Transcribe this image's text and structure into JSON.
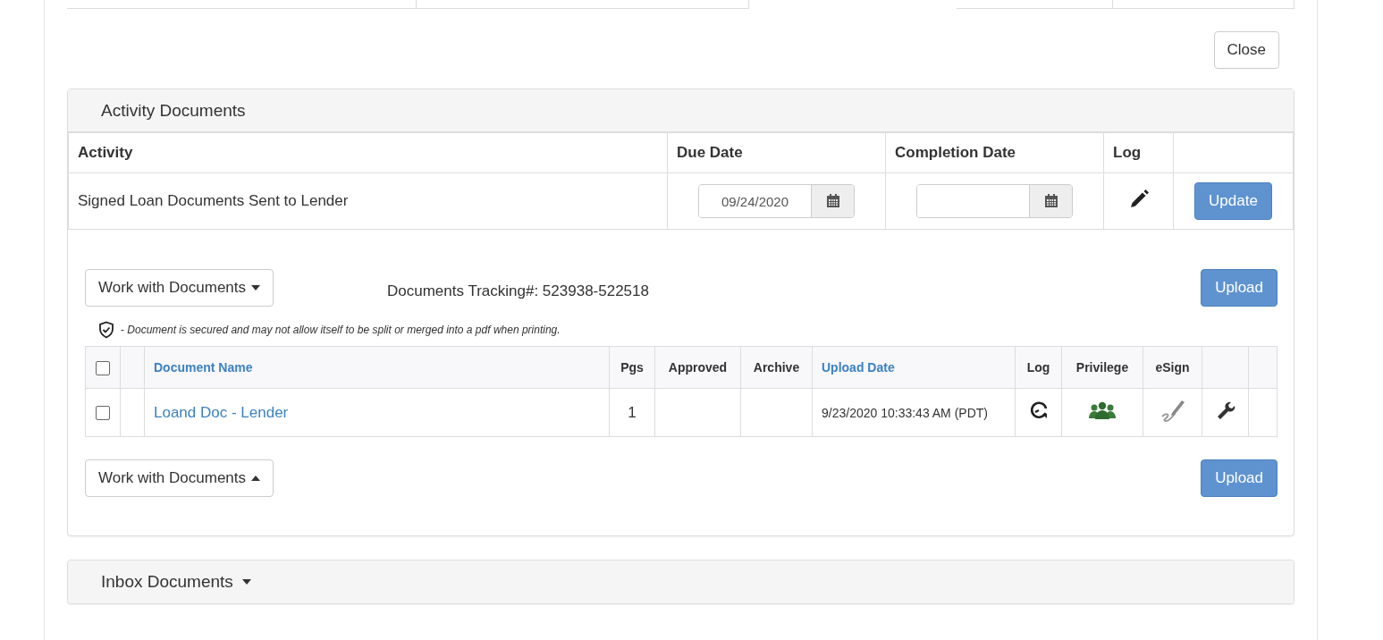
{
  "close_button": "Close",
  "activity_documents": {
    "title": "Activity Documents",
    "columns": [
      "Activity",
      "Due Date",
      "Completion Date",
      "Log"
    ],
    "rows": [
      {
        "activity": "Signed Loan Documents Sent to Lender",
        "due_date": "09/24/2020",
        "completion_date": "",
        "button": "Update"
      }
    ]
  },
  "work_with_documents_top": "Work with Documents",
  "tracking": "Documents Tracking#: 523938-522518",
  "upload_top": "Upload",
  "secured_note": "- *Document is secured and may not allow itself to be split or merged into a pdf when printing.*",
  "documents": {
    "select_all": {
      "checked": false
    },
    "columns": [
      {
        "label": "Document Name",
        "sortable": true
      },
      {
        "label": "Pgs",
        "sortable": false
      },
      {
        "label": "Approved",
        "sortable": false
      },
      {
        "label": "Archive",
        "sortable": false
      },
      {
        "label": "Upload Date",
        "sortable": true
      },
      {
        "label": "Log",
        "sortable": false
      },
      {
        "label": "Privilege",
        "sortable": false
      },
      {
        "label": "eSign",
        "sortable": false
      }
    ],
    "rows": [
      {
        "checked": false,
        "name": "Loand Doc - Lender",
        "pgs": "1",
        "approved": "",
        "archive": "",
        "upload_date": "9/23/2020 10:33:43 AM (PDT)"
      }
    ]
  },
  "work_with_documents_bottom": "Work with Documents",
  "upload_bottom": "Upload",
  "inbox_documents": {
    "title": "Inbox Documents",
    "expanded": false
  }
}
